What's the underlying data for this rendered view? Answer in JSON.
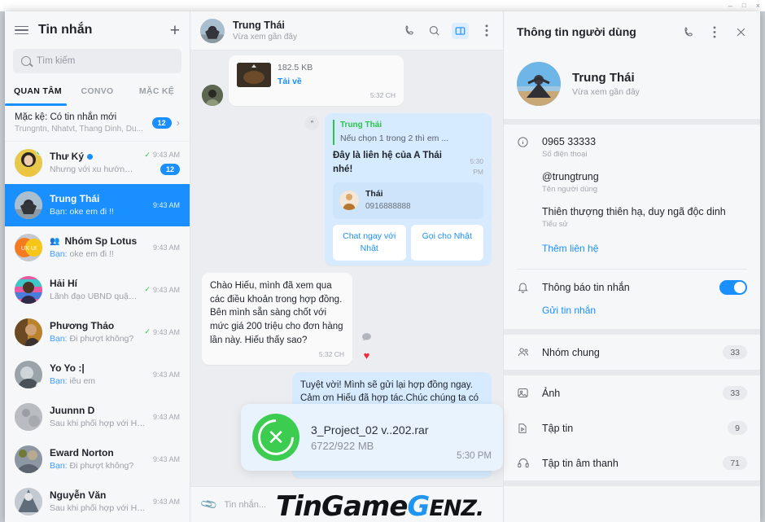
{
  "window": {
    "minimize": "–",
    "maximize": "□",
    "close": "×"
  },
  "sidebar": {
    "title": "Tin nhắn",
    "menu_icon": "hamburger-icon",
    "add_icon": "plus-icon",
    "search": {
      "placeholder": "Tìm kiếm"
    },
    "tabs": [
      {
        "label": "QUAN TÂM",
        "active": true
      },
      {
        "label": "CONVO",
        "active": false
      },
      {
        "label": "MẶC KỆ",
        "active": false
      }
    ],
    "ignored": {
      "title": "Mặc kệ: Có tin nhắn mới",
      "subtitle": "Trungntn, Nhatvt, Thang Dinh, Du...",
      "badge": "12",
      "chevron": "›"
    },
    "conversations": [
      {
        "name": "Thư Ký",
        "message": "Nhưng với xu hướng hiện n...",
        "time": "9:43 AM",
        "tick": true,
        "badge": "12",
        "online": true,
        "unread_dot": true,
        "group": false,
        "prefix": ""
      },
      {
        "name": "Trung Thái",
        "message": "oke em đi !!",
        "prefix": "Bạn:",
        "time": "9:43 AM",
        "tick": false,
        "selected": true,
        "group": false
      },
      {
        "name": "Nhóm Sp Lotus",
        "message": "oke em đi !!",
        "prefix": "Bạn:",
        "time": "9:43 AM",
        "tick": false,
        "group": true
      },
      {
        "name": "Hải Hí",
        "message": "Lãnh đạo UBND quận Than...",
        "prefix": "",
        "time": "9:43 AM",
        "tick": true,
        "group": false
      },
      {
        "name": "Phương Thảo",
        "message": "Đi phượt không?",
        "prefix": "Bạn:",
        "time": "9:43 AM",
        "tick": true,
        "group": false
      },
      {
        "name": "Yo Yo :|",
        "message": "iêu em",
        "prefix": "Bạn:",
        "time": "9:43 AM",
        "tick": false,
        "group": false,
        "offline": true
      },
      {
        "name": "Juunnn D",
        "message": "Sau khi phối hợp với Hà Đô...",
        "prefix": "",
        "time": "9:43 AM",
        "tick": false,
        "group": false
      },
      {
        "name": "Eward Norton",
        "message": "Đi phượt không?",
        "prefix": "Bạn:",
        "time": "9:43 AM",
        "tick": false,
        "group": false
      },
      {
        "name": "Nguyễn Văn",
        "message": "Sau khi phối hợp với Hà Đô...",
        "prefix": "",
        "time": "9:43 AM",
        "tick": false,
        "group": false
      }
    ]
  },
  "chat": {
    "header": {
      "name": "Trung Thái",
      "status": "Vừa xem gần đây",
      "icons": [
        "phone-icon",
        "search-icon",
        "sidebar-toggle-icon",
        "more-vertical-icon"
      ]
    },
    "messages": {
      "file_msg": {
        "size": "182.5 KB",
        "download": "Tải về",
        "time": "5:32 CH"
      },
      "contact_msg": {
        "quote_name": "Trung Thái",
        "quote_text": "Nếu chọn 1 trong 2 thì em ...",
        "text": "Đây là liên hệ của A Thái nhé!",
        "time": "5:30 PM",
        "contact_name": "Thái",
        "contact_phone": "0916888888",
        "buttons": [
          "Chat ngay với Nhật",
          "Gọi cho Nhật"
        ]
      },
      "incoming": {
        "text": "Chào Hiếu, mình đã xem qua các điều khoản trong hợp đồng. Bên mình sẵn sàng chốt với mức giá  200 triệu cho đơn hàng lần này. Hiếu thấy sao?",
        "time": "5:32 CH",
        "reactions": [
          "reply-icon",
          "heart-reaction"
        ]
      },
      "outgoing": {
        "text": "Tuyệt vời! Mình sẽ gửi lại hợp đồng ngay. Cảm ơn Hiếu đã hợp tác.Chúc chúng ta có thêm nhiều giao dịch thành công trong tương lai. Tốt quá",
        "time": "5:30 PM"
      }
    },
    "toast": {
      "filename": "3_Project_02 v..202.rar",
      "progress": "6722/922 MB",
      "time": "5:30 PM",
      "icon": "cancel-download-icon"
    },
    "composer": {
      "attach_icon": "paperclip-icon",
      "placeholder": "Tin nhắn..."
    }
  },
  "watermark": {
    "part1": "TinGame",
    "g": "G",
    "part2": "ENZ."
  },
  "info": {
    "title": "Thông tin người dùng",
    "icons": [
      "phone-icon",
      "more-vertical-icon",
      "close-icon"
    ],
    "profile": {
      "name": "Trung Thái",
      "status": "Vừa xem gần đây"
    },
    "fields": [
      {
        "icon": "info-circle-icon",
        "value": "0965 33333",
        "label": "Số điện thoại"
      },
      {
        "icon": "",
        "value": "@trungtrung",
        "label": "Tên người dùng"
      },
      {
        "icon": "",
        "value": "Thiên thượng thiên hạ, duy ngã độc dinh",
        "label": "Tiểu sử"
      }
    ],
    "add_contact": "Thêm liên hệ",
    "notify": {
      "icon": "bell-icon",
      "label": "Thông báo tin nhắn",
      "on": true
    },
    "send_message": "Gửi tin nhắn",
    "nav": [
      {
        "icon": "people-icon",
        "label": "Nhóm chung",
        "count": "33"
      },
      {
        "icon": "image-icon",
        "label": "Ảnh",
        "count": "33"
      },
      {
        "icon": "file-icon",
        "label": "Tập tin",
        "count": "9"
      },
      {
        "icon": "headphones-icon",
        "label": "Tập tin âm thanh",
        "count": "71"
      }
    ]
  }
}
